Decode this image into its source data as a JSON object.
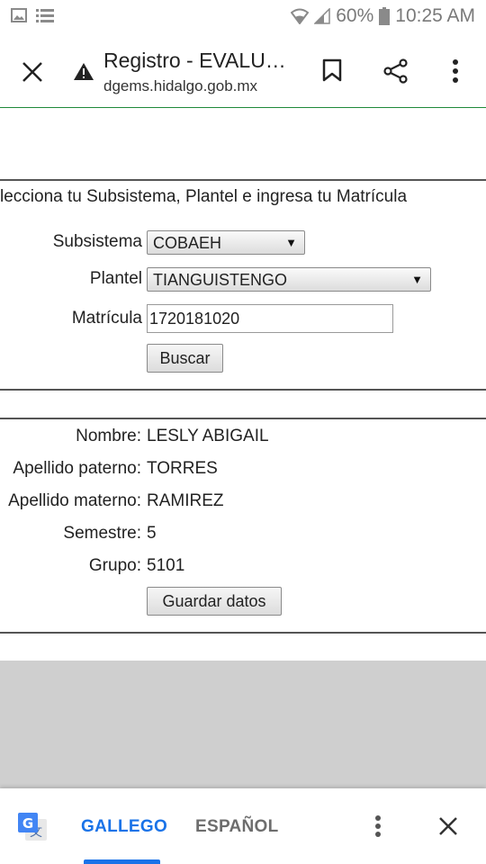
{
  "status_bar": {
    "battery": "60%",
    "time": "10:25 AM"
  },
  "toolbar": {
    "title": "Registro - EVALU…",
    "url": "dgems.hidalgo.gob.mx"
  },
  "form": {
    "instruction": "lecciona tu Subsistema, Plantel e ingresa tu Matrícula",
    "subsistema_label": "Subsistema",
    "subsistema_value": "COBAEH",
    "plantel_label": "Plantel",
    "plantel_value": "TIANGUISTENGO",
    "matricula_label": "Matrícula",
    "matricula_value": "1720181020",
    "buscar_label": "Buscar"
  },
  "results": {
    "rows": [
      {
        "label": "Nombre:",
        "value": "LESLY ABIGAIL"
      },
      {
        "label": "Apellido paterno:",
        "value": "TORRES"
      },
      {
        "label": "Apellido materno:",
        "value": "RAMIREZ"
      },
      {
        "label": "Semestre:",
        "value": "5"
      },
      {
        "label": "Grupo:",
        "value": "5101"
      }
    ],
    "save_label": "Guardar datos"
  },
  "translate": {
    "lang_source": "GALLEGO",
    "lang_target": "ESPAÑOL",
    "active_color": "#1a73e8",
    "inactive_color": "#6d6d6d"
  }
}
